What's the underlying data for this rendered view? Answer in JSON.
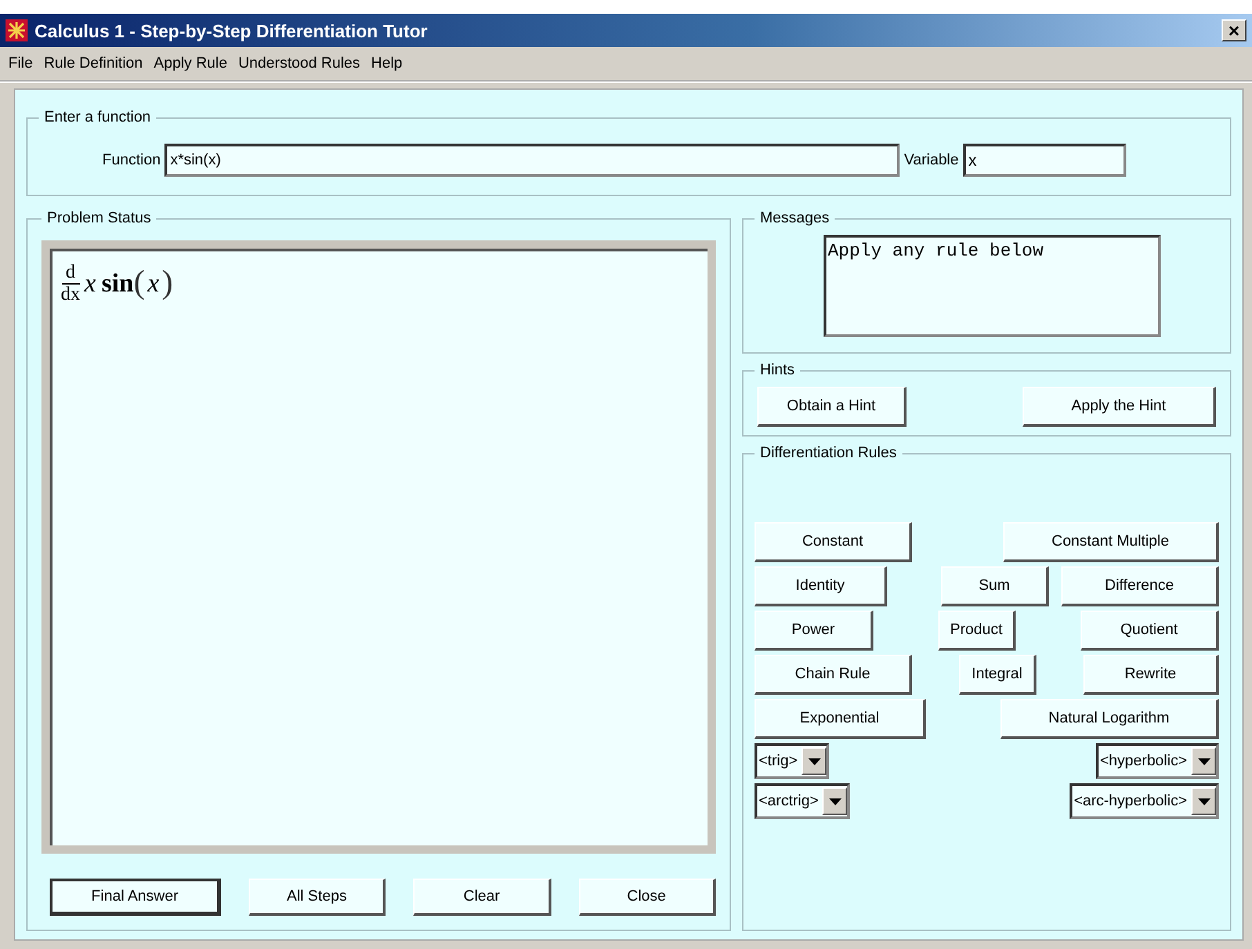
{
  "window": {
    "title": "Calculus 1 - Step-by-Step Differentiation Tutor",
    "close": "×"
  },
  "menu": [
    "File",
    "Rule Definition",
    "Apply Rule",
    "Understood Rules",
    "Help"
  ],
  "input_group": {
    "title": "Enter a function",
    "function_label": "Function",
    "function_value": "x*sin(x)",
    "variable_label": "Variable",
    "variable_value": "x"
  },
  "problem_status": {
    "title": "Problem Status",
    "expression": {
      "operator_top": "d",
      "operator_bottom": "dx",
      "factor": "x",
      "function": "sin",
      "open": "(",
      "argument": "x",
      "close": ")"
    },
    "buttons": [
      {
        "label": "Final Answer",
        "default": true
      },
      {
        "label": "All Steps",
        "default": false
      },
      {
        "label": "Clear",
        "default": false
      },
      {
        "label": "Close",
        "default": false
      }
    ]
  },
  "messages": {
    "title": "Messages",
    "text": "Apply any rule below"
  },
  "hints": {
    "title": "Hints",
    "buttons": [
      "Obtain a Hint",
      "Apply the Hint"
    ]
  },
  "rules": {
    "title": "Differentiation Rules",
    "rows": [
      [
        "Constant",
        "Constant Multiple"
      ],
      [
        "Identity",
        "Sum",
        "Difference"
      ],
      [
        "Power",
        "Product",
        "Quotient"
      ],
      [
        "Chain Rule",
        "Integral",
        "Rewrite"
      ],
      [
        "Exponential",
        "Natural Logarithm"
      ]
    ],
    "dropdowns": [
      [
        "<trig>",
        "<hyperbolic>"
      ],
      [
        "<arctrig>",
        "<arc-hyperbolic>"
      ]
    ]
  }
}
